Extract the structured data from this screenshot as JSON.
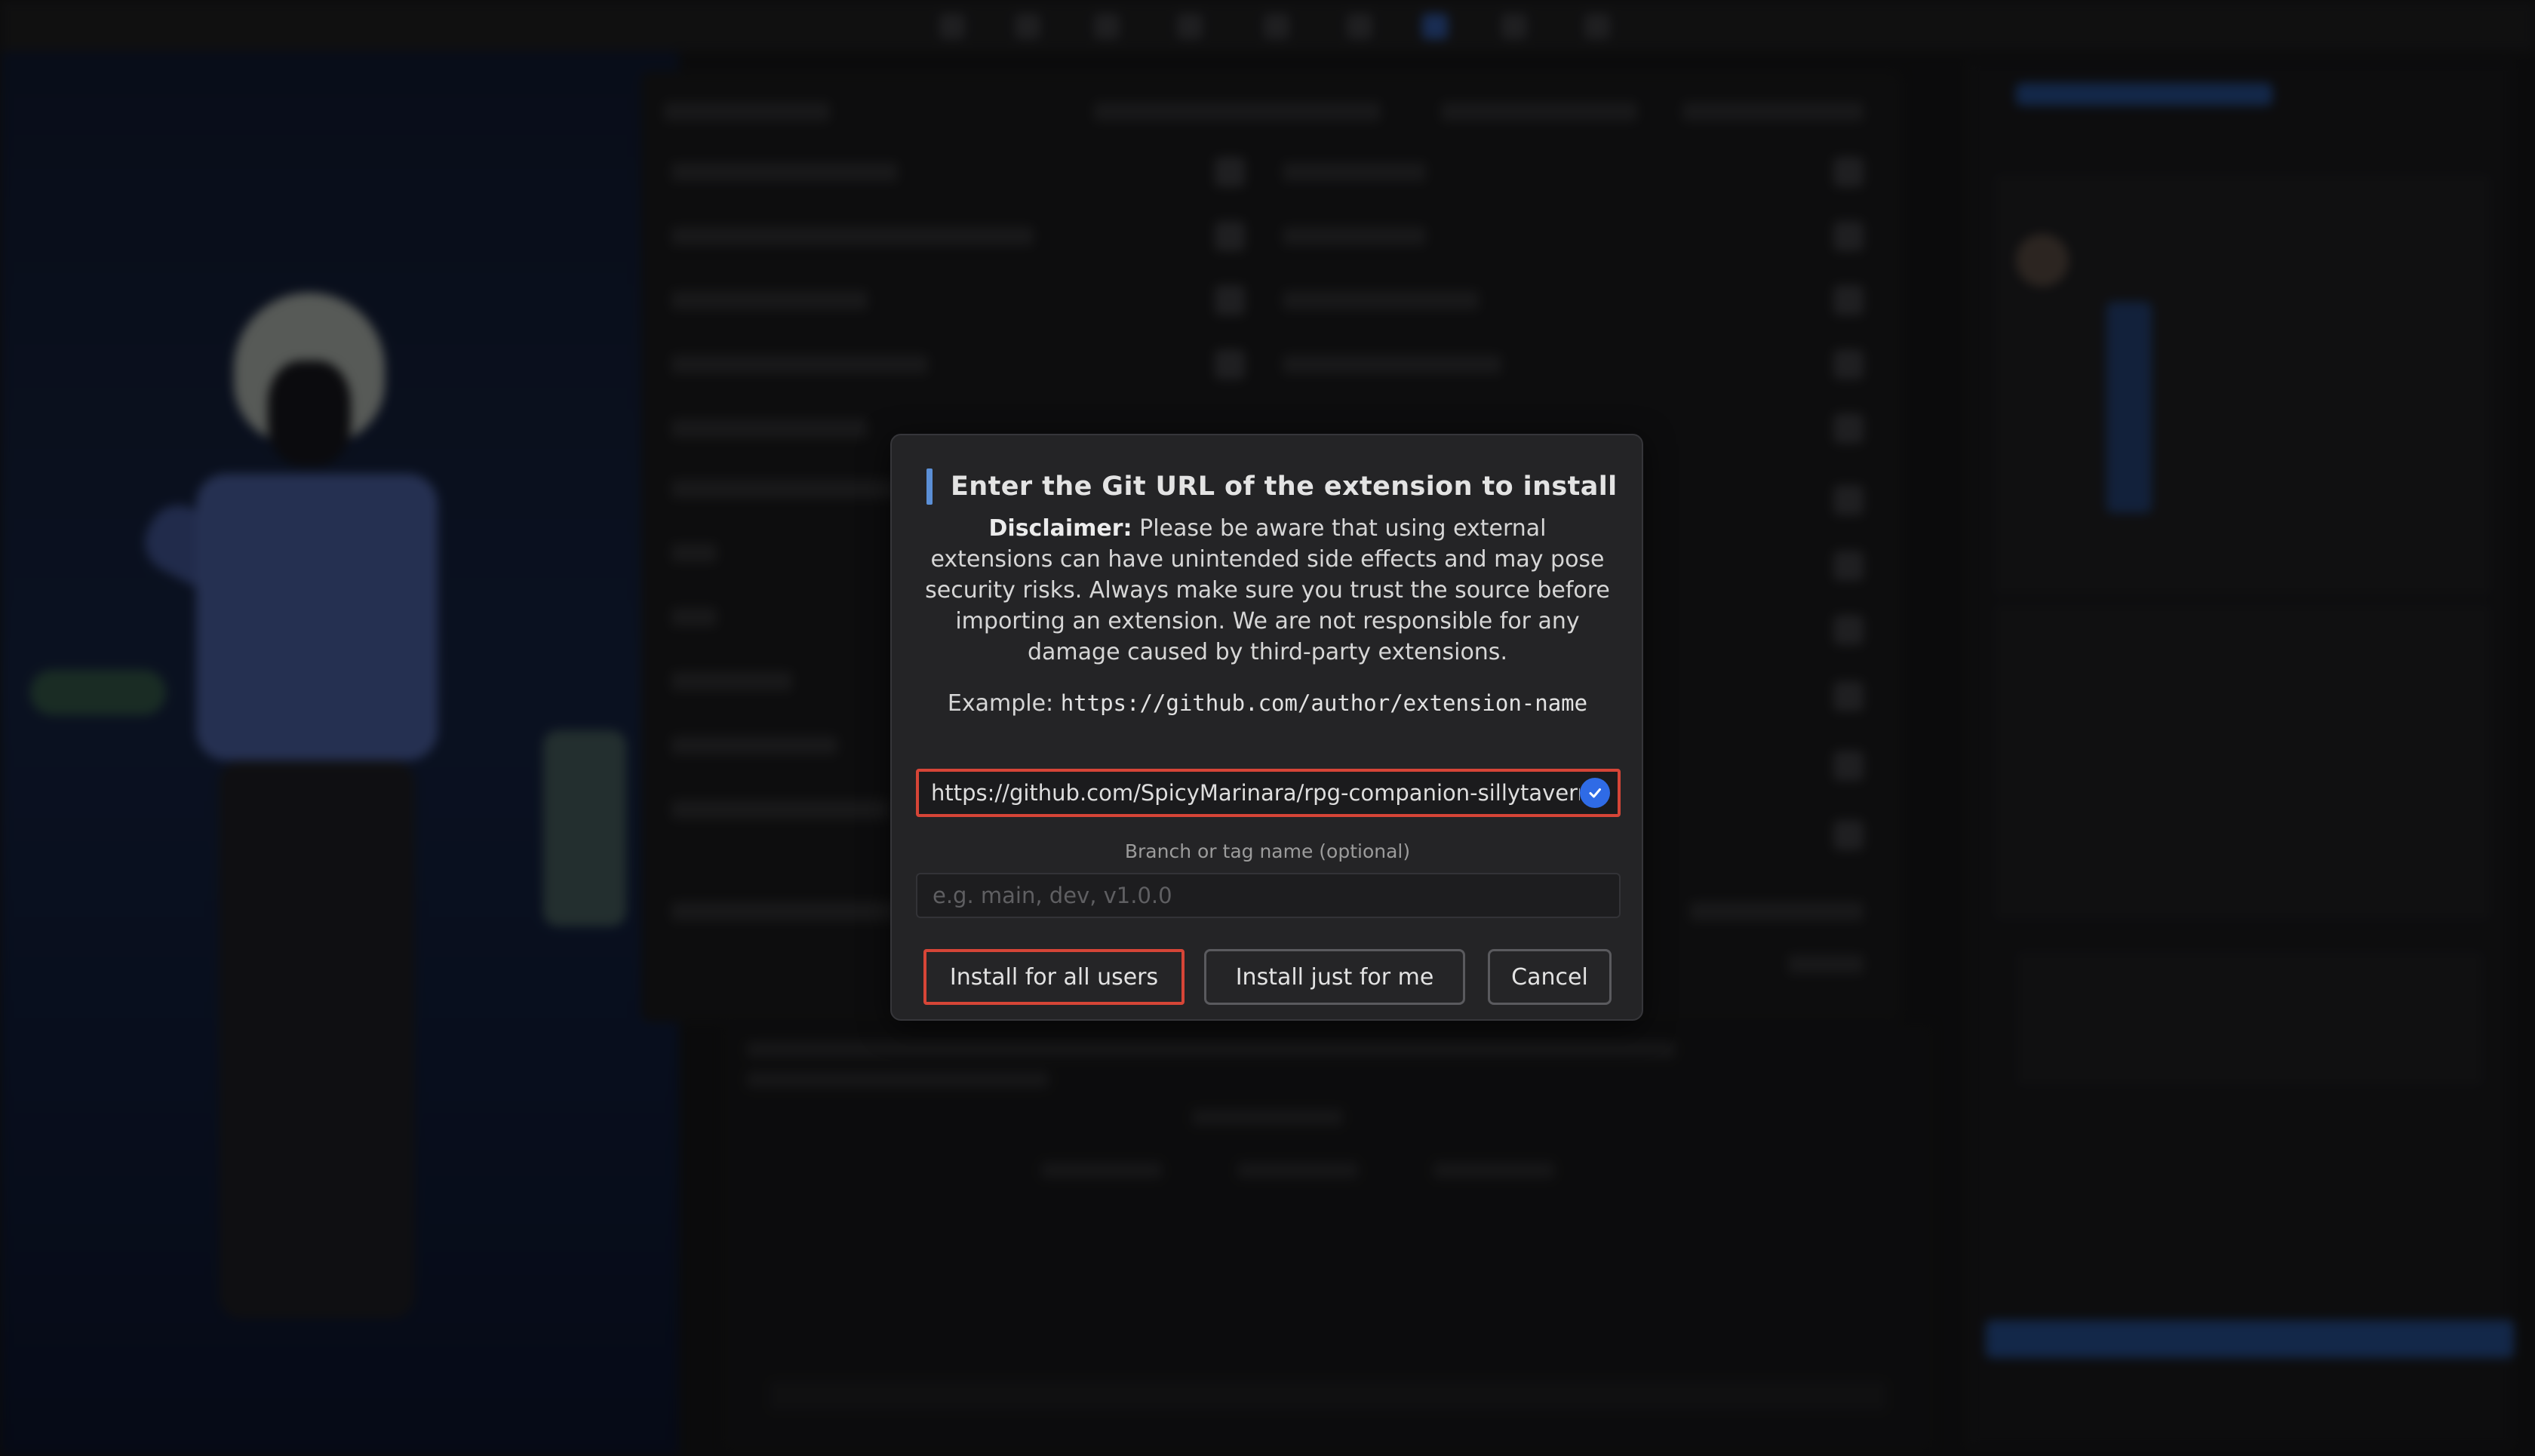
{
  "dialog": {
    "title": "Enter the Git URL of the extension to install",
    "disclaimer_label": "Disclaimer:",
    "disclaimer_text": "Please be aware that using external extensions can have unintended side effects and may pose security risks. Always make sure you trust the source before importing an extension. We are not responsible for any damage caused by third-party extensions.",
    "example_label": "Example:",
    "example_url": "https://github.com/author/extension-name",
    "url_value": "https://github.com/SpicyMarinara/rpg-companion-sillytavern",
    "branch_label": "Branch or tag name (optional)",
    "branch_placeholder": "e.g. main, dev, v1.0.0",
    "buttons": {
      "install_all": "Install for all users",
      "install_me": "Install just for me",
      "cancel": "Cancel"
    }
  },
  "colors": {
    "highlight_border": "#d64537",
    "accent_bar": "#5b8fd6",
    "check_badge": "#2f6be6"
  },
  "icons": {
    "url_valid": "check-circle-icon"
  }
}
